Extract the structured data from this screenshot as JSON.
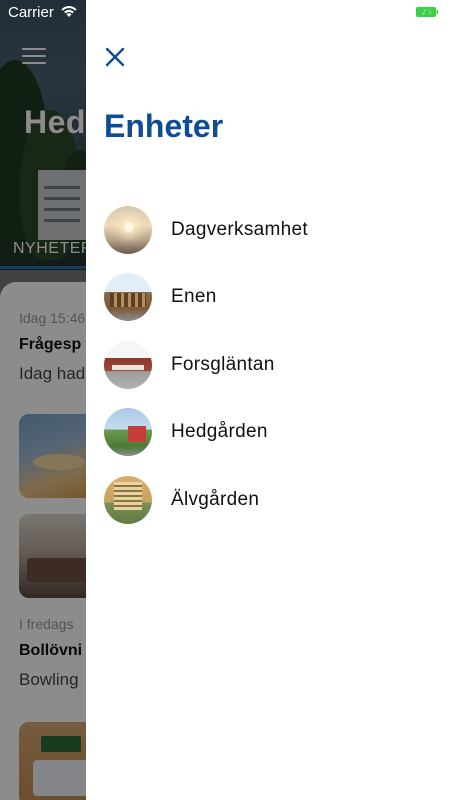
{
  "status_bar": {
    "carrier": "Carrier",
    "wifi_icon": "wifi-icon",
    "battery_icon": "battery-icon"
  },
  "background": {
    "hero_title": "Hed",
    "menu_icon": "hamburger-menu-icon",
    "tab_label": "NYHETER",
    "feed": [
      {
        "meta": "Idag 15:46",
        "title": "Frågesp",
        "text": "Idag had"
      },
      {
        "meta": "I fredags",
        "title": "Bollövni",
        "text": "Bowling"
      }
    ]
  },
  "drawer": {
    "close_icon": "close-icon",
    "title": "Enheter",
    "units": [
      {
        "label": "Dagverksamhet"
      },
      {
        "label": "Enen"
      },
      {
        "label": "Forsgläntan"
      },
      {
        "label": "Hedgården"
      },
      {
        "label": "Älvgården"
      }
    ]
  },
  "colors": {
    "accent": "#0e4d96",
    "battery": "#3ecf4a",
    "overlay": "rgba(0,0,0,0.45)"
  }
}
